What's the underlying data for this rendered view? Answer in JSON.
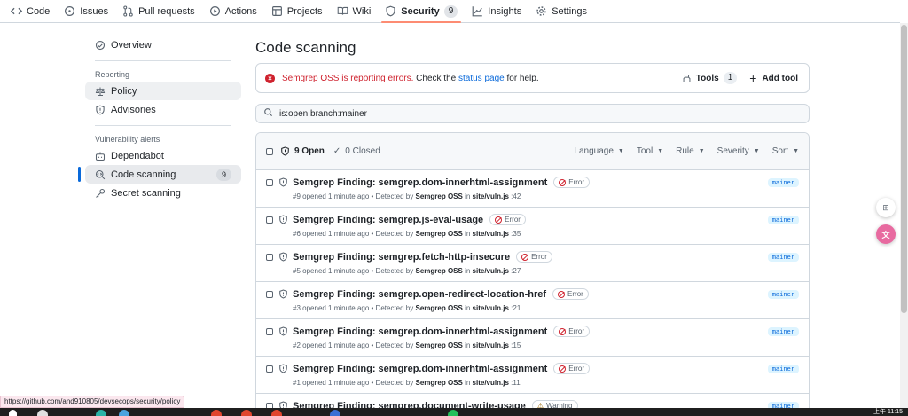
{
  "repo_nav": {
    "tabs": [
      {
        "label": "Code",
        "icon": "code-icon"
      },
      {
        "label": "Issues",
        "icon": "issue-icon"
      },
      {
        "label": "Pull requests",
        "icon": "pull-request-icon"
      },
      {
        "label": "Actions",
        "icon": "play-icon"
      },
      {
        "label": "Projects",
        "icon": "table-icon"
      },
      {
        "label": "Wiki",
        "icon": "book-icon"
      },
      {
        "label": "Security",
        "icon": "shield-icon",
        "count": "9",
        "active": true
      },
      {
        "label": "Insights",
        "icon": "graph-icon"
      },
      {
        "label": "Settings",
        "icon": "gear-icon"
      }
    ]
  },
  "sidebar": {
    "overview": "Overview",
    "reporting_heading": "Reporting",
    "policy": "Policy",
    "advisories": "Advisories",
    "vuln_heading": "Vulnerability alerts",
    "dependabot": "Dependabot",
    "code_scanning": "Code scanning",
    "code_scanning_count": "9",
    "secret_scanning": "Secret scanning"
  },
  "main": {
    "title": "Code scanning",
    "banner": {
      "error_link": "Semgrep OSS is reporting errors.",
      "text_before_link": " Check the ",
      "status_link": "status page",
      "text_after_link": " for help.",
      "tools_label": "Tools",
      "tools_count": "1",
      "add_tool_label": "Add tool"
    },
    "search_value": "is:open branch:mainer",
    "list_header": {
      "open_label": "9 Open",
      "closed_label": "0 Closed",
      "filters": [
        "Language",
        "Tool",
        "Rule",
        "Severity",
        "Sort"
      ]
    },
    "alerts": [
      {
        "title": "Semgrep Finding: semgrep.dom-innerhtml-assignment",
        "severity": "Error",
        "number": "#9",
        "opened": "opened 1 minute ago • Detected by",
        "tool": "Semgrep OSS",
        "in": "in",
        "file": "site/vuln.js",
        "line": ":42",
        "branch": "mainer"
      },
      {
        "title": "Semgrep Finding: semgrep.js-eval-usage",
        "severity": "Error",
        "number": "#6",
        "opened": "opened 1 minute ago • Detected by",
        "tool": "Semgrep OSS",
        "in": "in",
        "file": "site/vuln.js",
        "line": ":35",
        "branch": "mainer"
      },
      {
        "title": "Semgrep Finding: semgrep.fetch-http-insecure",
        "severity": "Error",
        "number": "#5",
        "opened": "opened 1 minute ago • Detected by",
        "tool": "Semgrep OSS",
        "in": "in",
        "file": "site/vuln.js",
        "line": ":27",
        "branch": "mainer"
      },
      {
        "title": "Semgrep Finding: semgrep.open-redirect-location-href",
        "severity": "Error",
        "number": "#3",
        "opened": "opened 1 minute ago • Detected by",
        "tool": "Semgrep OSS",
        "in": "in",
        "file": "site/vuln.js",
        "line": ":21",
        "branch": "mainer"
      },
      {
        "title": "Semgrep Finding: semgrep.dom-innerhtml-assignment",
        "severity": "Error",
        "number": "#2",
        "opened": "opened 1 minute ago • Detected by",
        "tool": "Semgrep OSS",
        "in": "in",
        "file": "site/vuln.js",
        "line": ":15",
        "branch": "mainer"
      },
      {
        "title": "Semgrep Finding: semgrep.dom-innerhtml-assignment",
        "severity": "Error",
        "number": "#1",
        "opened": "opened 1 minute ago • Detected by",
        "tool": "Semgrep OSS",
        "in": "in",
        "file": "site/vuln.js",
        "line": ":11",
        "branch": "mainer"
      },
      {
        "title": "Semgrep Finding: semgrep.document-write-usage",
        "severity": "Warning",
        "number": "",
        "opened": "",
        "tool": "",
        "in": "",
        "file": "",
        "line": "",
        "branch": "mainer"
      }
    ]
  },
  "status_url": "https://github.com/and910805/devsecops/security/policy",
  "taskbar_time": "上午 11:15",
  "colors": {
    "accent": "#0969da",
    "danger": "#cf222e",
    "active_tab_underline": "#fd8c73"
  }
}
